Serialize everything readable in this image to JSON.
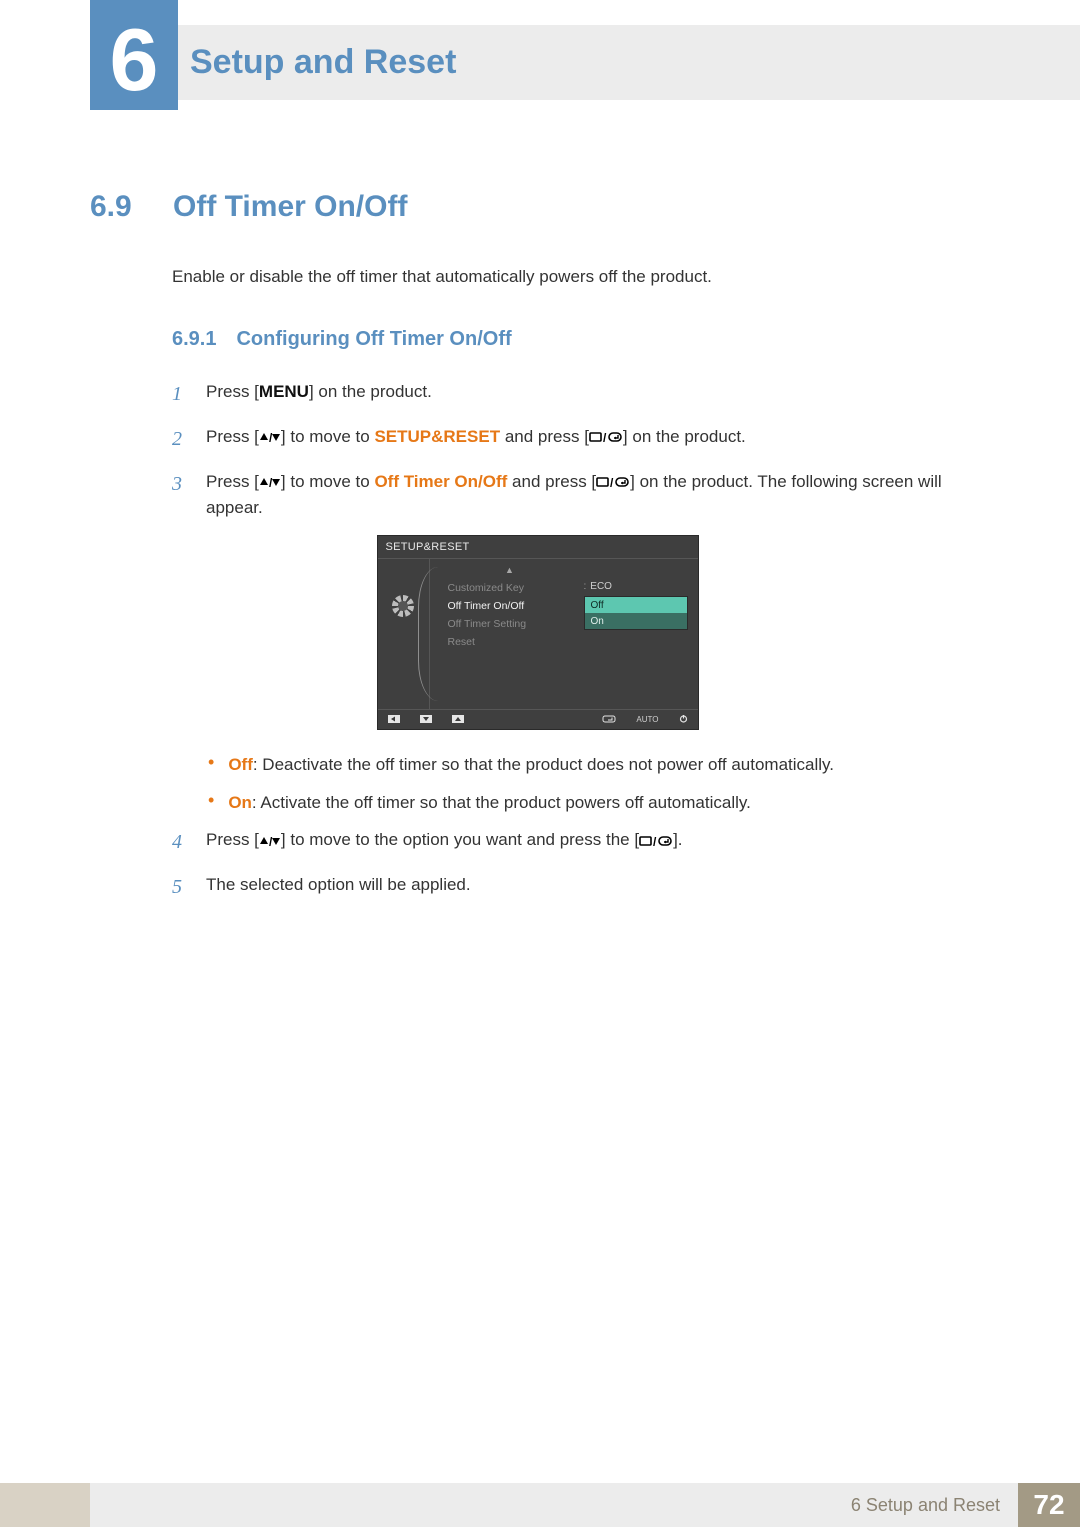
{
  "chapter": {
    "num": "6",
    "title": "Setup and Reset"
  },
  "section": {
    "num": "6.9",
    "title": "Off Timer On/Off"
  },
  "intro": "Enable or disable the off timer that automatically powers off the product.",
  "subsection": {
    "num": "6.9.1",
    "title": "Configuring Off Timer On/Off"
  },
  "steps": {
    "s1": {
      "n": "1",
      "a": "Press [",
      "menu": "MENU",
      "b": "] on the product."
    },
    "s2": {
      "n": "2",
      "a": "Press [",
      "b": "] to move to ",
      "target": "SETUP&RESET",
      "c": " and press [",
      "d": "] on the product."
    },
    "s3": {
      "n": "3",
      "a": "Press [",
      "b": "] to move to ",
      "target": "Off Timer On/Off",
      "c": " and press [",
      "d": "] on the product. The following screen will appear."
    },
    "s4": {
      "n": "4",
      "a": "Press [",
      "b": "] to move to the option you want and press the [",
      "c": "]."
    },
    "s5": {
      "n": "5",
      "a": "The selected option will be applied."
    }
  },
  "bullets": {
    "off": {
      "label": "Off",
      "text": ": Deactivate the off timer so that the product does not power off automatically."
    },
    "on": {
      "label": "On",
      "text": ": Activate the off timer so that the product powers off automatically."
    }
  },
  "osd": {
    "title": "SETUP&RESET",
    "items": {
      "i1": "Customized Key",
      "i2": "Off Timer On/Off",
      "i3": "Off Timer Setting",
      "i4": "Reset"
    },
    "valueEco": "ECO",
    "optOff": "Off",
    "optOn": "On",
    "auto": "AUTO"
  },
  "footer": {
    "label": "6 Setup and Reset",
    "page": "72"
  }
}
